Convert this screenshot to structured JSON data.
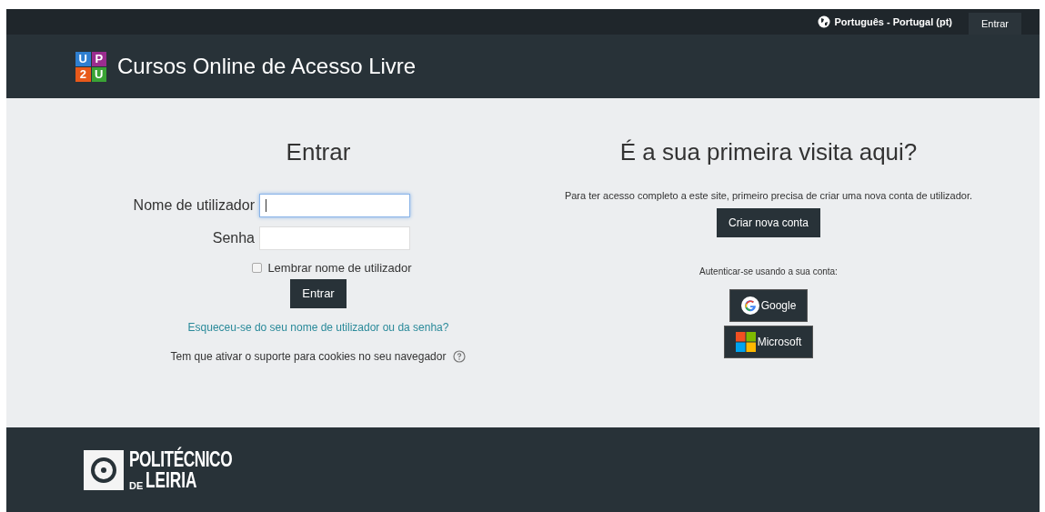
{
  "top_bar": {
    "language": "Português - Portugal (pt)",
    "login_button": "Entrar"
  },
  "header": {
    "logo_tiles": [
      {
        "text": "U",
        "color": "#2f7fd0"
      },
      {
        "text": "P",
        "color": "#9b2d8f"
      },
      {
        "text": "2",
        "color": "#e8591a"
      },
      {
        "text": "U",
        "color": "#3aa335"
      }
    ],
    "site_name": "Cursos Online de Acesso Livre"
  },
  "login": {
    "title": "Entrar",
    "fields": [
      {
        "label": "Nome de utilizador",
        "focused": true
      },
      {
        "label": "Senha",
        "focused": false
      }
    ],
    "remember": {
      "label": "Lembrar nome de utilizador",
      "checked": false
    },
    "submit": "Entrar",
    "forgot_link": "Esqueceu-se do seu nome de utilizador ou da senha?",
    "cookies_note": "Tem que ativar o suporte para cookies no seu navegador"
  },
  "signup": {
    "title": "É a sua primeira visita aqui?",
    "text": "Para ter acesso completo a este site, primeiro precisa de criar uma nova conta de utilizador.",
    "button": "Criar nova conta",
    "auth_label": "Autenticar-se usando a sua conta:",
    "providers": [
      {
        "kind": "google",
        "label": "Google"
      },
      {
        "kind": "microsoft",
        "label": "Microsoft"
      }
    ]
  },
  "footer": {
    "logo_line_1": "POLITÉCNICO",
    "logo_prefix": "DE",
    "logo_line_2": "LEIRIA"
  }
}
